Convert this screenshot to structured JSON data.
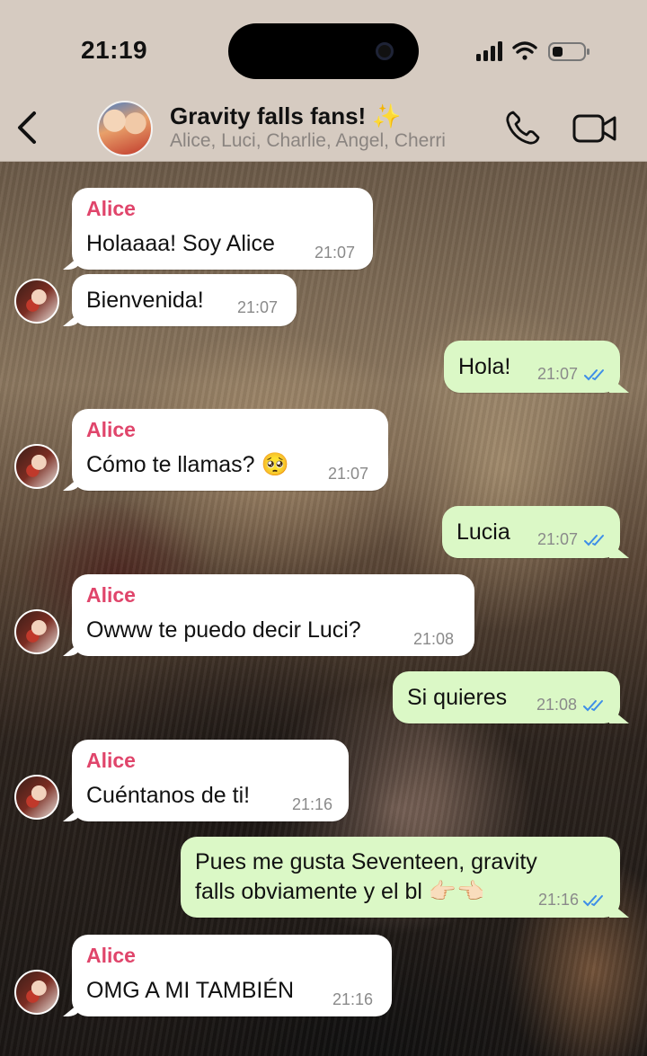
{
  "status_bar": {
    "time": "21:19"
  },
  "header": {
    "title": "Gravity falls fans! ✨",
    "members": "Alice, Luci, Charlie, Angel, Cherri"
  },
  "colors": {
    "sender_name": "#e0456b",
    "outgoing_bubble": "#dbf8c6",
    "incoming_bubble": "#ffffff",
    "read_checks": "#3d8ee8"
  },
  "messages": [
    {
      "dir": "in",
      "sender": "Alice",
      "text": "Holaaaa! Soy Alice",
      "time": "21:07"
    },
    {
      "dir": "in",
      "text": "Bienvenida!",
      "time": "21:07"
    },
    {
      "dir": "out",
      "text": "Hola!",
      "time": "21:07",
      "status": "read"
    },
    {
      "dir": "in",
      "sender": "Alice",
      "text": "Cómo te llamas? 🥺",
      "time": "21:07"
    },
    {
      "dir": "out",
      "text": "Lucia",
      "time": "21:07",
      "status": "read"
    },
    {
      "dir": "in",
      "sender": "Alice",
      "text": "Owww te puedo decir Luci?",
      "time": "21:08"
    },
    {
      "dir": "out",
      "text": "Si quieres",
      "time": "21:08",
      "status": "read"
    },
    {
      "dir": "in",
      "sender": "Alice",
      "text": "Cuéntanos de ti!",
      "time": "21:16"
    },
    {
      "dir": "out",
      "line1": "Pues me gusta Seventeen, gravity",
      "line2": "falls obviamente y el bl 👉🏻👈🏻",
      "time": "21:16",
      "status": "read"
    },
    {
      "dir": "in",
      "sender": "Alice",
      "text": "OMG A MI TAMBIÉN",
      "time": "21:16"
    }
  ]
}
